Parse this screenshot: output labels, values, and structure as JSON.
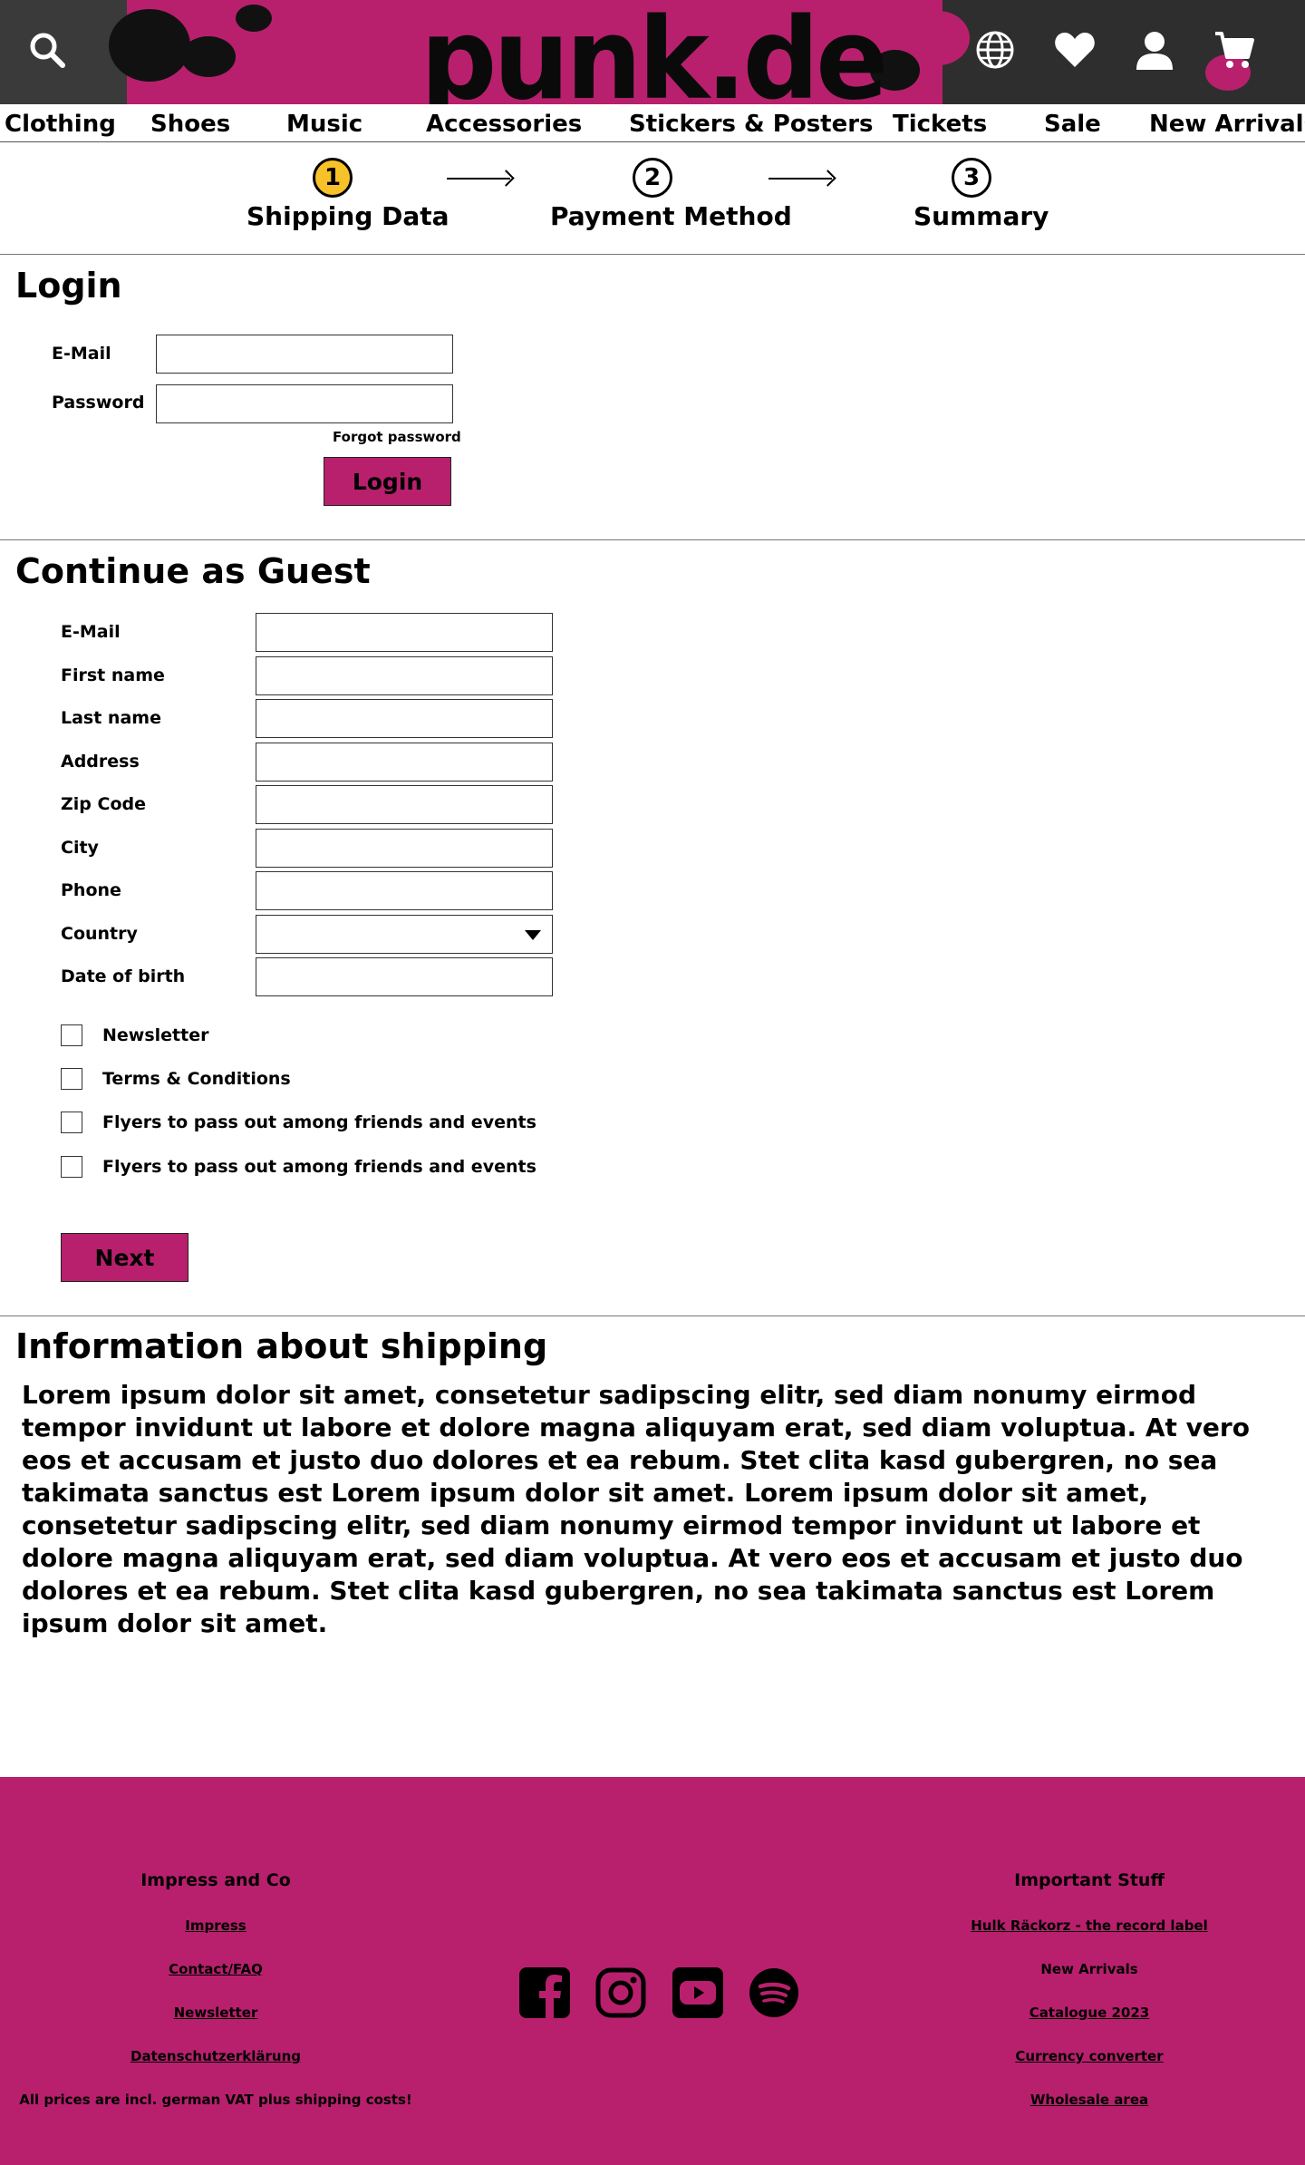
{
  "header": {
    "logo_text": "punk.de",
    "icons": [
      "search-icon",
      "globe-icon",
      "heart-icon",
      "user-icon",
      "cart-icon"
    ],
    "brand_color": "#b8206d"
  },
  "nav": {
    "items": [
      "Clothing",
      "Shoes",
      "Music",
      "Accessories",
      "Stickers & Posters",
      "Tickets",
      "Sale",
      "New Arrivals"
    ]
  },
  "steps": [
    {
      "number": "1",
      "label": "Shipping Data",
      "active": true
    },
    {
      "number": "2",
      "label": "Payment Method",
      "active": false
    },
    {
      "number": "3",
      "label": "Summary",
      "active": false
    }
  ],
  "step_active_color": "#f7c12a",
  "login": {
    "title": "Login",
    "email_label": "E-Mail",
    "email_value": "",
    "password_label": "Password",
    "password_value": "",
    "forgot_label": "Forgot password",
    "button_label": "Login"
  },
  "guest": {
    "title": "Continue as Guest",
    "fields": [
      {
        "label": "E-Mail",
        "value": ""
      },
      {
        "label": "First name",
        "value": ""
      },
      {
        "label": "Last name",
        "value": ""
      },
      {
        "label": "Address",
        "value": ""
      },
      {
        "label": "Zip Code",
        "value": ""
      },
      {
        "label": "City",
        "value": ""
      },
      {
        "label": "Phone",
        "value": ""
      },
      {
        "label": "Country",
        "value": ""
      },
      {
        "label": "Date of birth",
        "value": ""
      }
    ],
    "checkboxes": [
      {
        "label": "Newsletter",
        "checked": false
      },
      {
        "label": "Terms & Conditions",
        "checked": false
      },
      {
        "label": "Flyers to pass out among friends and events",
        "checked": false
      },
      {
        "label": "Flyers to pass out among friends and events",
        "checked": false
      }
    ],
    "next_label": "Next"
  },
  "shipping_info": {
    "title": "Information about shipping",
    "text": "Lorem ipsum dolor sit amet, consetetur sadipscing elitr, sed diam nonumy eirmod tempor invidunt ut labore et dolore magna aliquyam erat, sed diam voluptua. At vero eos et accusam et justo duo dolores et ea rebum. Stet clita kasd gubergren, no sea takimata sanctus est Lorem ipsum dolor sit amet. Lorem ipsum dolor sit amet, consetetur sadipscing elitr, sed diam nonumy eirmod tempor invidunt ut labore et dolore magna aliquyam erat, sed diam voluptua. At vero eos et accusam et justo duo dolores et ea rebum. Stet clita kasd gubergren, no sea takimata sanctus est Lorem ipsum dolor sit amet."
  },
  "footer": {
    "left_title": "Impress and Co",
    "left_links": [
      "Impress",
      "Contact/FAQ",
      "Newsletter",
      "Datenschutzerklärung"
    ],
    "vat_note": "All prices are incl. german VAT plus shipping costs!",
    "social_icons": [
      "facebook-icon",
      "instagram-icon",
      "youtube-icon",
      "spotify-icon"
    ],
    "right_title": "Important Stuff",
    "right_links": [
      "Hulk Räckorz - the record label",
      "New Arrivals",
      "Catalogue 2023",
      "Currency converter",
      "Wholesale area"
    ]
  }
}
